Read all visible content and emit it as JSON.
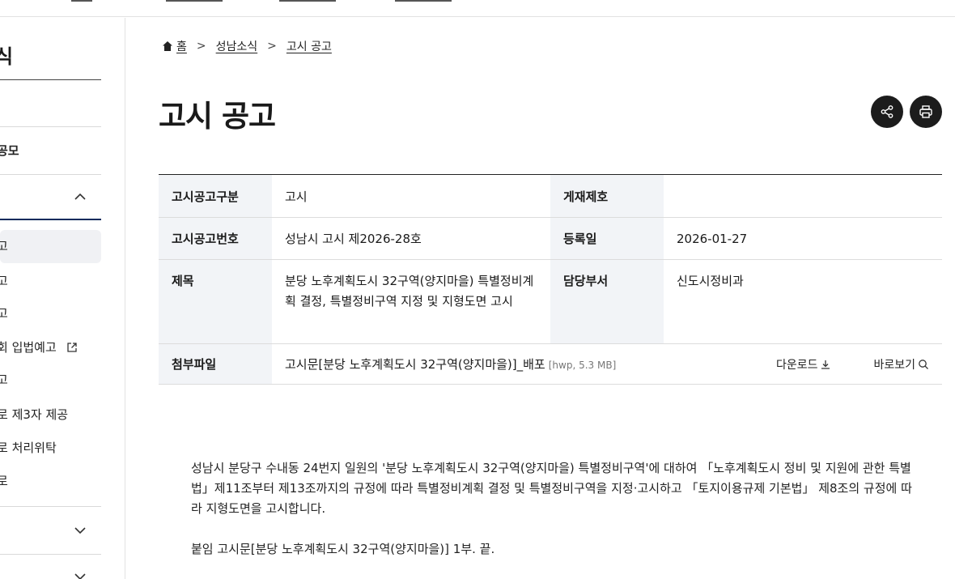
{
  "sidebar": {
    "title": "식",
    "items": [
      {
        "label": "공모"
      },
      {
        "label": "고"
      },
      {
        "label": "고"
      },
      {
        "label": "고"
      },
      {
        "label": "회 입법예고"
      },
      {
        "label": "고"
      },
      {
        "label": "로 제3자 제공"
      },
      {
        "label": "로 처리위탁"
      },
      {
        "label": "로"
      }
    ]
  },
  "breadcrumb": {
    "home": "홈",
    "level1": "성남소식",
    "level2": "고시 공고"
  },
  "page_title": "고시 공고",
  "detail": {
    "category_label": "고시공고구분",
    "category_value": "고시",
    "post_no_label": "게재제호",
    "post_no_value": "",
    "notice_no_label": "고시공고번호",
    "notice_no_value": "성남시 고시 제2026-28호",
    "reg_date_label": "등록일",
    "reg_date_value": "2026-01-27",
    "subject_label": "제목",
    "subject_value": "분당 노후계획도시 32구역(양지마을) 특별정비계획 결정, 특별정비구역 지정 및 지형도면 고시",
    "dept_label": "담당부서",
    "dept_value": "신도시정비과",
    "attachment_label": "첨부파일",
    "attachment_name": "고시문[분당 노후계획도시 32구역(양지마을)]_배포",
    "attachment_meta": "[hwp, 5.3 MB]",
    "download_label": "다운로드",
    "view_label": "바로보기"
  },
  "body": {
    "paragraph1": "성남시 분당구 수내동 24번지 일원의 '분당 노후계획도시 32구역(양지마을) 특별정비구역'에 대하여 「노후계획도시 정비 및 지원에 관한 특별법」제11조부터 제13조까지의 규정에 따라 특별정비계획 결정 및 특별정비구역을 지정·고시하고 「토지이용규제 기본법」 제8조의 규정에 따라 지형도면을 고시합니다.",
    "paragraph2": "붙임 고시문[분당 노후계획도시 32구역(양지마을)] 1부. 끝."
  }
}
